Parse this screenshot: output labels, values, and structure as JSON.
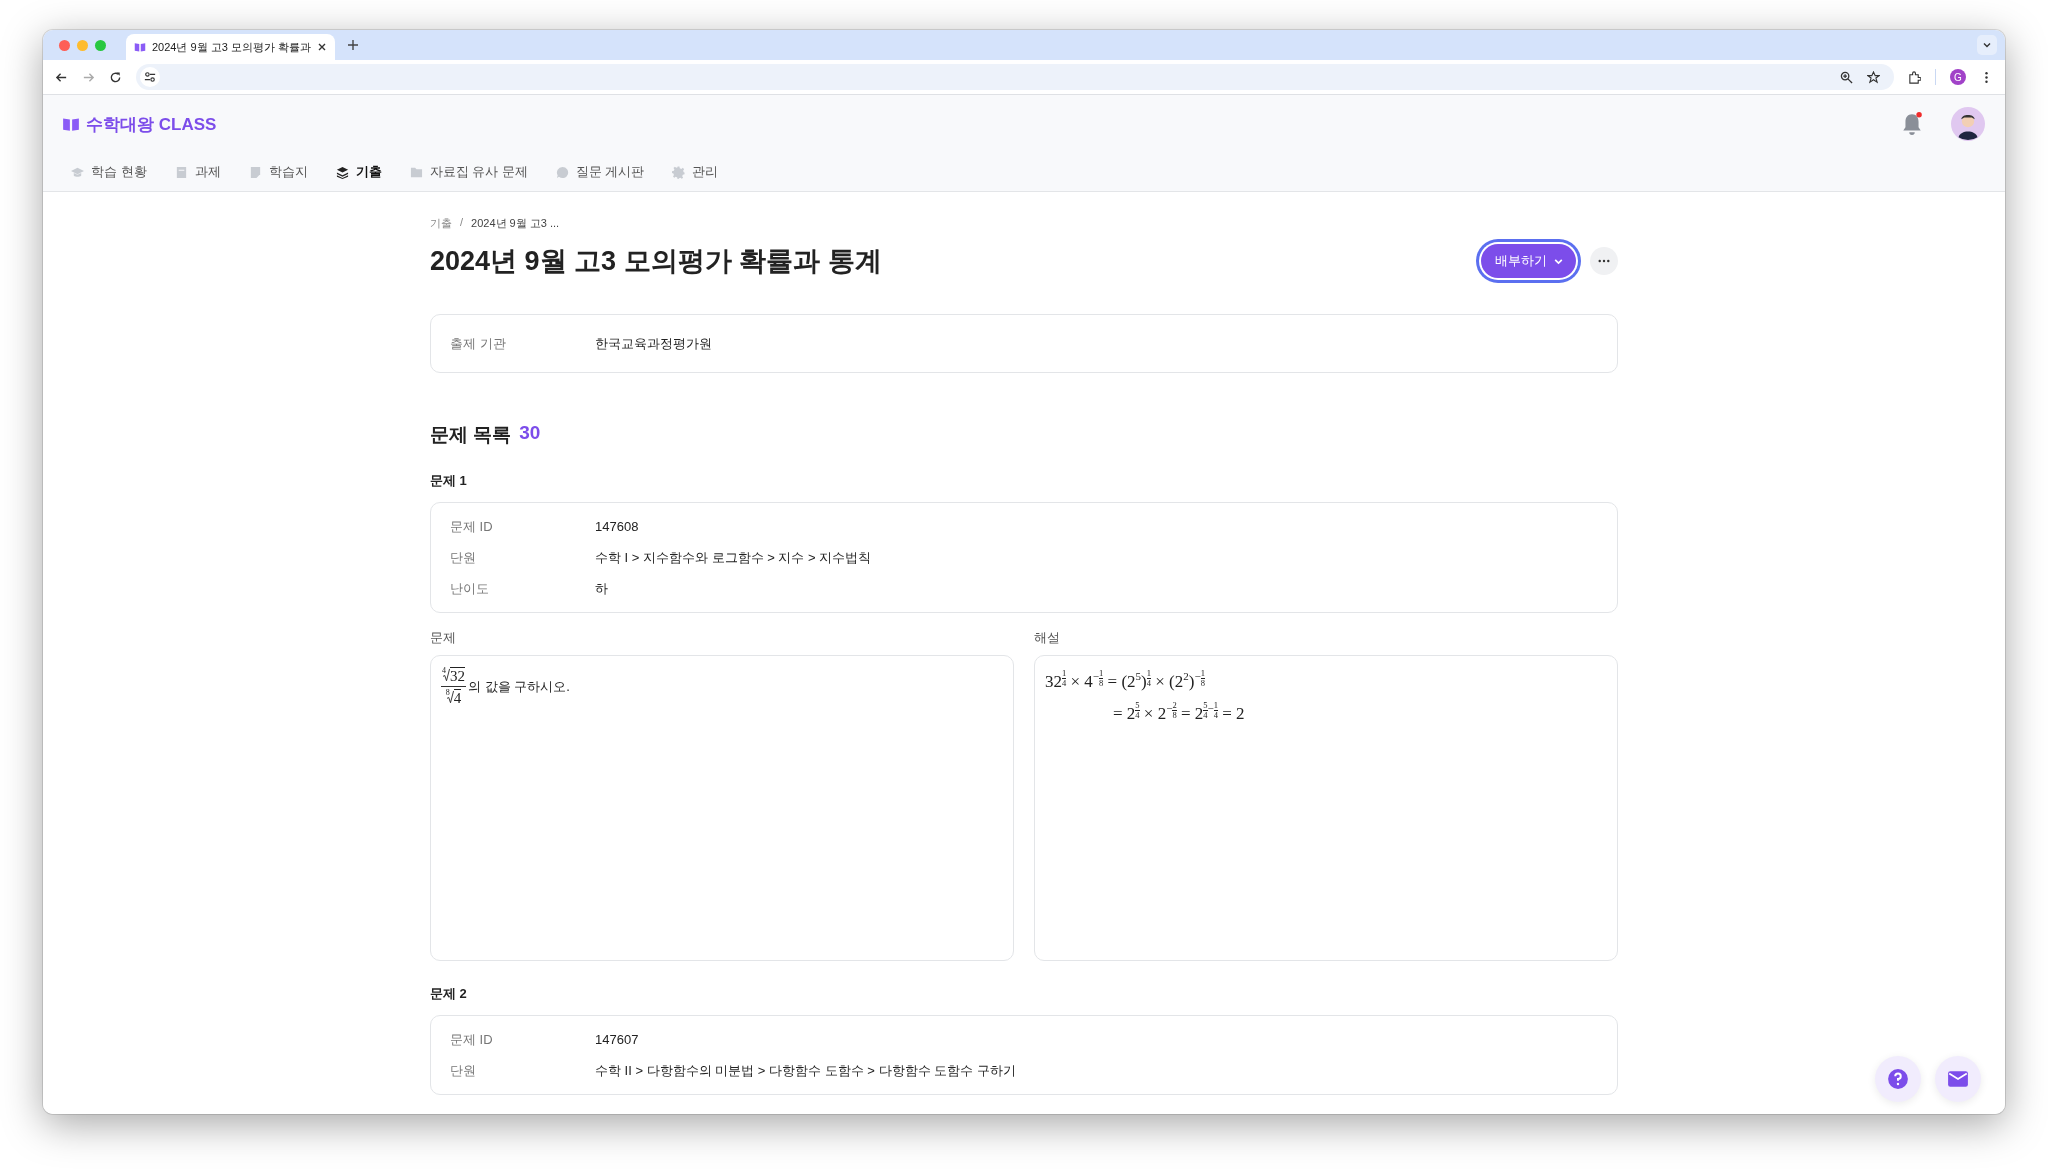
{
  "browser": {
    "tab_title": "2024년 9월 고3 모의평가 확률과",
    "profile_initial": "G"
  },
  "app": {
    "logo": "수학대왕 CLASS",
    "notification_unread": true,
    "nav": [
      {
        "label": "학습 현황",
        "selected": false
      },
      {
        "label": "과제",
        "selected": false
      },
      {
        "label": "학습지",
        "selected": false
      },
      {
        "label": "기출",
        "selected": true
      },
      {
        "label": "자료집 유사 문제",
        "selected": false
      },
      {
        "label": "질문 게시판",
        "selected": false
      },
      {
        "label": "관리",
        "selected": false
      }
    ]
  },
  "breadcrumb": [
    "기출",
    "2024년 9월 고3 ..."
  ],
  "breadcrumb_separator": "/",
  "title": "2024년 9월 고3 모의평가 확률과 통계",
  "distribute_button": {
    "label": "배부하기",
    "focused": true
  },
  "info": [
    {
      "label": "출제 기관",
      "value": "한국교육과정평가원"
    }
  ],
  "list_heading": "문제 목록",
  "list_count": "30",
  "problems": [
    {
      "title": "문제 1",
      "fields": [
        {
          "label": "문제 ID",
          "value": "147608"
        },
        {
          "label": "단원",
          "value": "수학 I > 지수함수와 로그함수 > 지수 > 지수법칙"
        },
        {
          "label": "난이도",
          "value": "하"
        }
      ],
      "question_label": "문제",
      "solution_label": "해설",
      "question": [
        {
          "kind": "frac",
          "num": {
            "index": "4",
            "radicand": "32"
          },
          "den": {
            "index": "8",
            "radicand": "4"
          }
        },
        {
          "kind": "text",
          "text": "의 값을 구하시오."
        }
      ],
      "solution": [
        [
          {
            "kind": "text",
            "text": "32"
          },
          {
            "kind": "sup",
            "parts": [
              {
                "num": "1",
                "den": "4"
              }
            ]
          },
          {
            "kind": "text",
            "text": " × 4"
          },
          {
            "kind": "sup",
            "parts": [
              "−",
              {
                "num": "1",
                "den": "8"
              }
            ]
          },
          {
            "kind": "text",
            "text": " = (2"
          },
          {
            "kind": "sup",
            "parts": [
              "5"
            ]
          },
          {
            "kind": "text",
            "text": ")"
          },
          {
            "kind": "sup",
            "parts": [
              {
                "num": "1",
                "den": "4"
              }
            ]
          },
          {
            "kind": "text",
            "text": " × (2"
          },
          {
            "kind": "sup",
            "parts": [
              "2"
            ]
          },
          {
            "kind": "text",
            "text": ")"
          },
          {
            "kind": "sup",
            "parts": [
              "−",
              {
                "num": "1",
                "den": "8"
              }
            ]
          }
        ],
        [
          {
            "kind": "text",
            "text": "= 2"
          },
          {
            "kind": "sup",
            "parts": [
              {
                "num": "5",
                "den": "4"
              }
            ]
          },
          {
            "kind": "text",
            "text": " × 2"
          },
          {
            "kind": "sup",
            "parts": [
              "−",
              {
                "num": "2",
                "den": "8"
              }
            ]
          },
          {
            "kind": "text",
            "text": " = 2"
          },
          {
            "kind": "sup",
            "parts": [
              {
                "num": "5",
                "den": "4"
              },
              "−",
              {
                "num": "1",
                "den": "4"
              }
            ]
          },
          {
            "kind": "text",
            "text": " = 2"
          }
        ]
      ]
    },
    {
      "title": "문제 2",
      "fields": [
        {
          "label": "문제 ID",
          "value": "147607"
        },
        {
          "label": "단원",
          "value": "수학 II > 다항함수의 미분법 > 다항함수 도함수 > 다항함수 도함수 구하기"
        }
      ]
    }
  ]
}
